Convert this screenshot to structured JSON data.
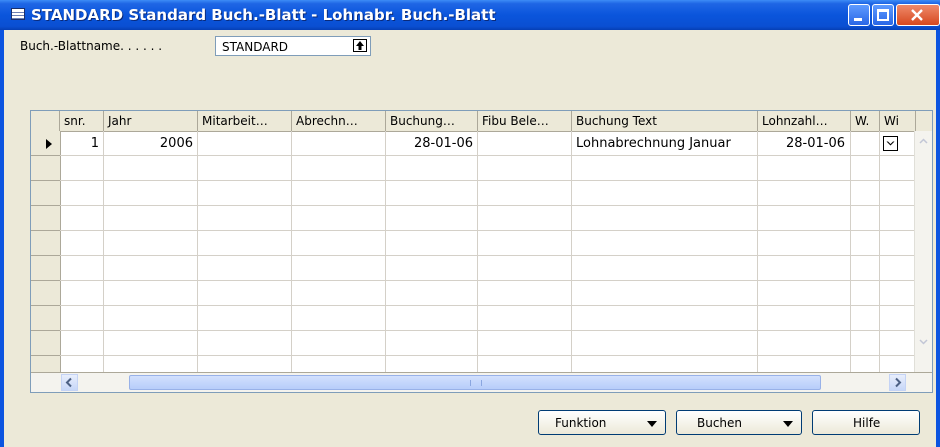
{
  "window": {
    "title": "STANDARD Standard Buch.-Blatt - Lohnabr. Buch.-Blatt"
  },
  "form": {
    "journal_label": "Buch.-Blattname. . . . . .",
    "journal_value": "STANDARD"
  },
  "grid": {
    "columns": [
      "snr.",
      "Jahr",
      "Mitarbeit…",
      "Abrechn…",
      "Buchung…",
      "Fibu Bele…",
      "Buchung Text",
      "Lohnzahl…",
      "W.",
      "Wi"
    ],
    "rows": [
      {
        "snr": "1",
        "jahr": "2006",
        "mitarbeiter": "",
        "abrechnung": "",
        "buchung": "28-01-06",
        "fibu_beleg": "",
        "text": "Lohnabrechnung Januar",
        "lohnzahlung": "28-01-06",
        "w": "",
        "wi": ""
      }
    ]
  },
  "buttons": {
    "funktion": "Funktion",
    "buchen": "Buchen",
    "hilfe": "Hilfe"
  },
  "colors": {
    "titlebar": "#0a55dc",
    "face": "#ece9d8"
  }
}
